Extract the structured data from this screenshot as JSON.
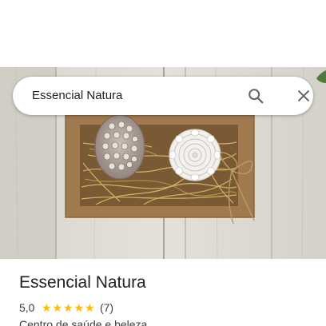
{
  "search": {
    "query": "Essencial Natura",
    "search_icon": "search-icon",
    "close_icon": "close-icon"
  },
  "place": {
    "name": "Essencial Natura",
    "rating": "5,0",
    "stars": 5,
    "reviews": "(7)",
    "category": "Centro de saúde e beleza"
  },
  "colors": {
    "star": "#fbbc04",
    "title": "#202124",
    "text": "#3c4043"
  }
}
